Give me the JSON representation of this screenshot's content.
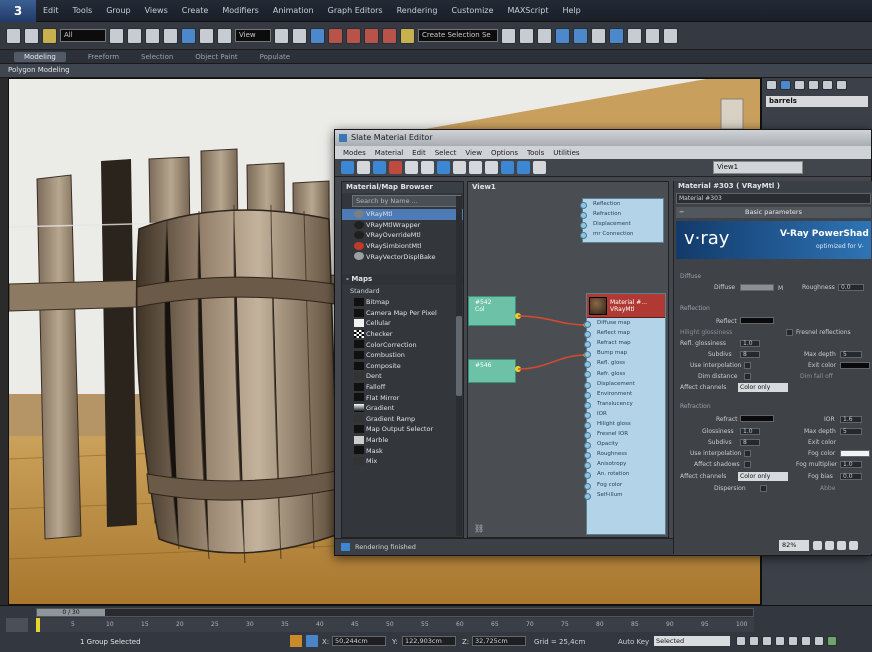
{
  "menubar": {
    "logo": "3",
    "items": [
      "Edit",
      "Tools",
      "Group",
      "Views",
      "Create",
      "Modifiers",
      "Animation",
      "Graph Editors",
      "Rendering",
      "Customize",
      "MAXScript",
      "Help"
    ]
  },
  "toolbar": {
    "selection_filter": "All",
    "ref_coord": "View",
    "named_selection": "Create Selection Se"
  },
  "ribbon": {
    "tabs": [
      "Modeling",
      "Freeform",
      "Selection",
      "Object Paint",
      "Populate"
    ],
    "sub_label": "Polygon Modeling"
  },
  "right_panel": {
    "object_name": "barrels"
  },
  "sme": {
    "title": "Slate Material Editor",
    "menu": [
      "Modes",
      "Material",
      "Edit",
      "Select",
      "View",
      "Options",
      "Tools",
      "Utilities"
    ],
    "view_dropdown": "View1",
    "browser": {
      "title": "Material/Map Browser",
      "search_placeholder": "Search by Name ...",
      "materials": [
        "VRayMtl",
        "VRayMtlWrapper",
        "VRayOverrideMtl",
        "VRaySimbiontMtl",
        "VRayVectorDisplBake"
      ],
      "maps_header": "- Maps",
      "maps_group": "Standard",
      "maps": [
        "Bitmap",
        "Camera Map Per Pixel",
        "Cellular",
        "Checker",
        "ColorCorrection",
        "Combustion",
        "Composite",
        "Dent",
        "Falloff",
        "Flat Mirror",
        "Gradient",
        "Gradient Ramp",
        "Map Output Selector",
        "Marble",
        "Mask",
        "Mix"
      ]
    },
    "view": {
      "title": "View1",
      "node_left_1_title": "#542",
      "node_left_1_sub": "Col",
      "node_left_2_title": "#546",
      "top_slots": [
        "Reflection",
        "Refraction",
        "Displacement",
        "mr Connection"
      ],
      "material_node_title": "Material #...",
      "material_node_sub": "VRayMtl",
      "slots": [
        "Diffuse map",
        "Reflect map",
        "Refract map",
        "Bump map",
        "Refl. gloss",
        "Refr. gloss",
        "Displacement",
        "Environment",
        "Translucency",
        "IOR",
        "Hilight gloss",
        "Fresnel IOR",
        "Opacity",
        "Roughness",
        "Anisotropy",
        "An. rotation",
        "Fog color",
        "Self-illum"
      ]
    },
    "params": {
      "header": "Material #303  ( VRayMtl )",
      "name_field": "Material #303",
      "rollout": "Basic parameters",
      "vray_logo": "v·ray",
      "banner": "V-Ray PowerShad",
      "banner_sub": "optimized for V-",
      "diffuse_group": "Diffuse",
      "diffuse": "Diffuse",
      "roughness": "Roughness",
      "roughness_value": "0.0",
      "m_label": "M",
      "reflection_group": "Reflection",
      "reflect": "Reflect",
      "hilight_gloss": "Hilight glossiness",
      "refl_gloss": "Refl. glossiness",
      "refl_gloss_value": "1.0",
      "subdivs": "Subdivs",
      "subdivs_value": "8",
      "use_interp": "Use interpolation",
      "dim_distance": "Dim distance",
      "affect_channels": "Affect channels",
      "affect_channels_value": "Color only",
      "fresnel": "Fresnel reflections",
      "max_depth": "Max depth",
      "max_depth_value": "5",
      "exit_color": "Exit color",
      "dim_falloff": "Dim fall off",
      "refraction_group": "Refraction",
      "refract": "Refract",
      "ior": "IOR",
      "ior_value": "1.6",
      "glossiness": "Glossiness",
      "glossiness_value": "1.0",
      "r_max_depth": "Max depth",
      "r_max_depth_value": "5",
      "r_subdivs": "Subdivs",
      "r_subdivs_value": "8",
      "exit_color2": "Exit color",
      "r_use_interp": "Use interpolation",
      "fog_color": "Fog color",
      "affect_shadows": "Affect shadows",
      "fog_mult": "Fog multiplier",
      "fog_mult_value": "1.0",
      "r_affect_channels": "Affect channels",
      "r_affect_channels_value": "Color only",
      "fog_bias": "Fog bias",
      "fog_bias_value": "0.0",
      "dispersion": "Dispersion",
      "abbe": "Abbe",
      "zoom": "82%"
    },
    "status": "Rendering finished"
  },
  "timeline": {
    "frame_counter": "0 / 30",
    "ticks": [
      "0",
      "5",
      "10",
      "15",
      "20",
      "25",
      "30",
      "35",
      "40",
      "45",
      "50",
      "55",
      "60",
      "65",
      "70",
      "75",
      "80",
      "85",
      "90",
      "95",
      "100"
    ]
  },
  "status": {
    "selected": "1 Group Selected",
    "x_label": "X:",
    "x_value": "50,244cm",
    "y_label": "Y:",
    "y_value": "122,903cm",
    "z_label": "Z:",
    "z_value": "32,725cm",
    "grid": "Grid = 25,4cm",
    "autokey": "Auto Key",
    "autokey_value": "Selected"
  }
}
